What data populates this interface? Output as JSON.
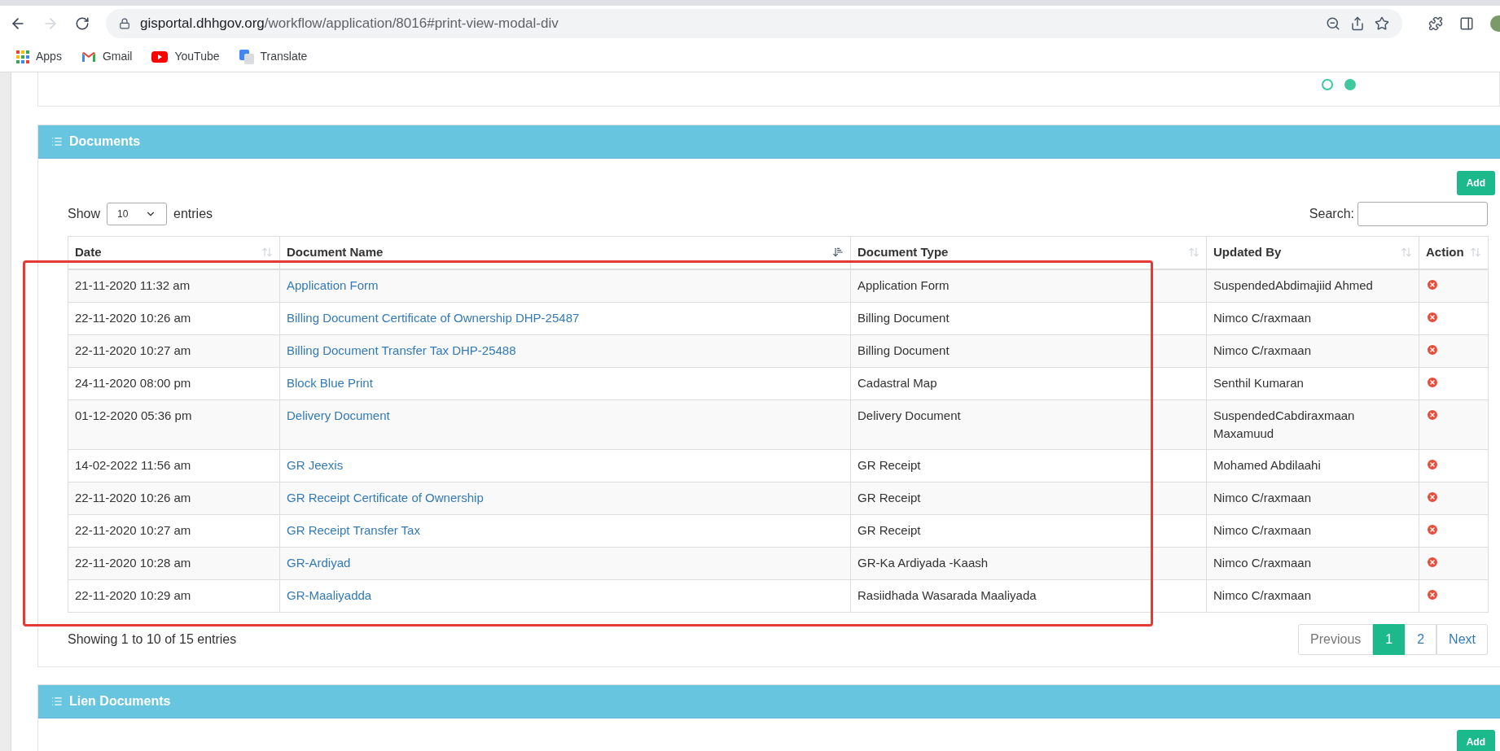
{
  "browser": {
    "url_host": "gisportal.dhhgov.org",
    "url_path": "/workflow/application/8016#print-view-modal-div",
    "forward_disabled": true,
    "bookmarks": [
      {
        "label": "Apps",
        "kind": "apps"
      },
      {
        "label": "Gmail",
        "kind": "gmail"
      },
      {
        "label": "YouTube",
        "kind": "youtube"
      },
      {
        "label": "Translate",
        "kind": "translate"
      }
    ]
  },
  "carousel_dots": [
    {
      "selected": false
    },
    {
      "selected": true
    }
  ],
  "documents": {
    "title": "Documents",
    "add_button": "Add",
    "show_label": "Show",
    "page_size": "10",
    "entries_label": "entries",
    "search_label": "Search:",
    "columns": [
      {
        "label": "Date",
        "sorted": false
      },
      {
        "label": "Document Name",
        "sorted": true
      },
      {
        "label": "Document Type",
        "sorted": false
      },
      {
        "label": "Updated By",
        "sorted": false
      },
      {
        "label": "Action",
        "sorted": false
      }
    ],
    "rows": [
      {
        "date": "21-11-2020 11:32 am",
        "name": "Application Form",
        "type": "Application Form",
        "updated_by": "SuspendedAbdimajiid Ahmed"
      },
      {
        "date": "22-11-2020 10:26 am",
        "name": "Billing Document Certificate of Ownership DHP-25487",
        "type": "Billing Document",
        "updated_by": "Nimco C/raxmaan"
      },
      {
        "date": "22-11-2020 10:27 am",
        "name": "Billing Document Transfer Tax DHP-25488",
        "type": "Billing Document",
        "updated_by": "Nimco C/raxmaan"
      },
      {
        "date": "24-11-2020 08:00 pm",
        "name": "Block Blue Print",
        "type": "Cadastral Map",
        "updated_by": "Senthil Kumaran"
      },
      {
        "date": "01-12-2020 05:36 pm",
        "name": "Delivery Document",
        "type": "Delivery Document",
        "updated_by": "SuspendedCabdiraxmaan Maxamuud"
      },
      {
        "date": "14-02-2022 11:56 am",
        "name": "GR Jeexis",
        "type": "GR Receipt",
        "updated_by": "Mohamed Abdilaahi"
      },
      {
        "date": "22-11-2020 10:26 am",
        "name": "GR Receipt Certificate of Ownership",
        "type": "GR Receipt",
        "updated_by": "Nimco C/raxmaan"
      },
      {
        "date": "22-11-2020 10:27 am",
        "name": "GR Receipt Transfer Tax",
        "type": "GR Receipt",
        "updated_by": "Nimco C/raxmaan"
      },
      {
        "date": "22-11-2020 10:28 am",
        "name": "GR-Ardiyad",
        "type": "GR-Ka Ardiyada -Kaash",
        "updated_by": "Nimco C/raxmaan"
      },
      {
        "date": "22-11-2020 10:29 am",
        "name": "GR-Maaliyadda",
        "type": "Rasiidhada Wasarada Maaliyada",
        "updated_by": "Nimco C/raxmaan"
      }
    ],
    "summary": "Showing 1 to 10 of 15 entries",
    "pagination": [
      {
        "label": "Previous",
        "kind": "prev",
        "selected": false
      },
      {
        "label": "1",
        "kind": "page",
        "selected": true
      },
      {
        "label": "2",
        "kind": "page",
        "selected": false
      },
      {
        "label": "Next",
        "kind": "next",
        "selected": false
      }
    ]
  },
  "lien_documents": {
    "title": "Lien Documents",
    "add_button": "Add"
  }
}
